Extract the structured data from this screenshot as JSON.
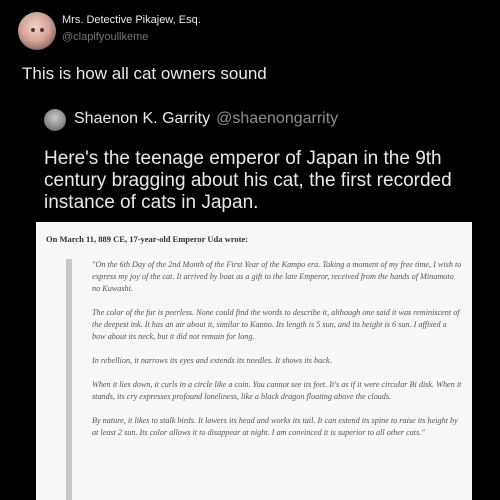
{
  "tweet": {
    "author_name": "Mrs. Detective Pikajew, Esq.",
    "author_handle": "@clapifyoullkeme",
    "text": "This is how all cat owners sound"
  },
  "quoted_tweet": {
    "author_name": "Shaenon K. Garrity",
    "author_handle": "@shaenongarrity",
    "text": "Here's the teenage emperor of Japan in the 9th century bragging about his cat, the first recorded instance of cats in Japan."
  },
  "document": {
    "heading": "On March 11, 889 CE, 17-year-old Emperor Uda wrote:",
    "paragraphs": [
      "\"On the 6th Day of the 2nd Month of the First Year of the Kampo era. Taking a moment of my free time, I wish to express my joy of the cat. It arrived by boat as a gift to the late Emperor, received from the hands of Minamoto no Kuwashi.",
      "The color of the fur is peerless. None could find the words to describe it, although one said it was reminiscent of the deepest ink. It has an air about it, similar to Kanno. Its length is 5 sun, and its height is 6 sun. I affixed a bow about its neck, but it did not remain for long.",
      "In rebellion, it narrows its eyes and extends its needles. It shows its back.",
      "When it lies down, it curls in a circle like a coin. You cannot see its feet. It's as if it were circular Bi disk. When it stands, its cry expresses profound loneliness, like a black dragon floating above the clouds.",
      "By nature, it likes to stalk birds. It lowers its head and works its tail. It can extend its spine to raise its height by at least 2 sun. Its color allows it to disappear at night. I am convinced it is superior to all other cats.\""
    ]
  }
}
